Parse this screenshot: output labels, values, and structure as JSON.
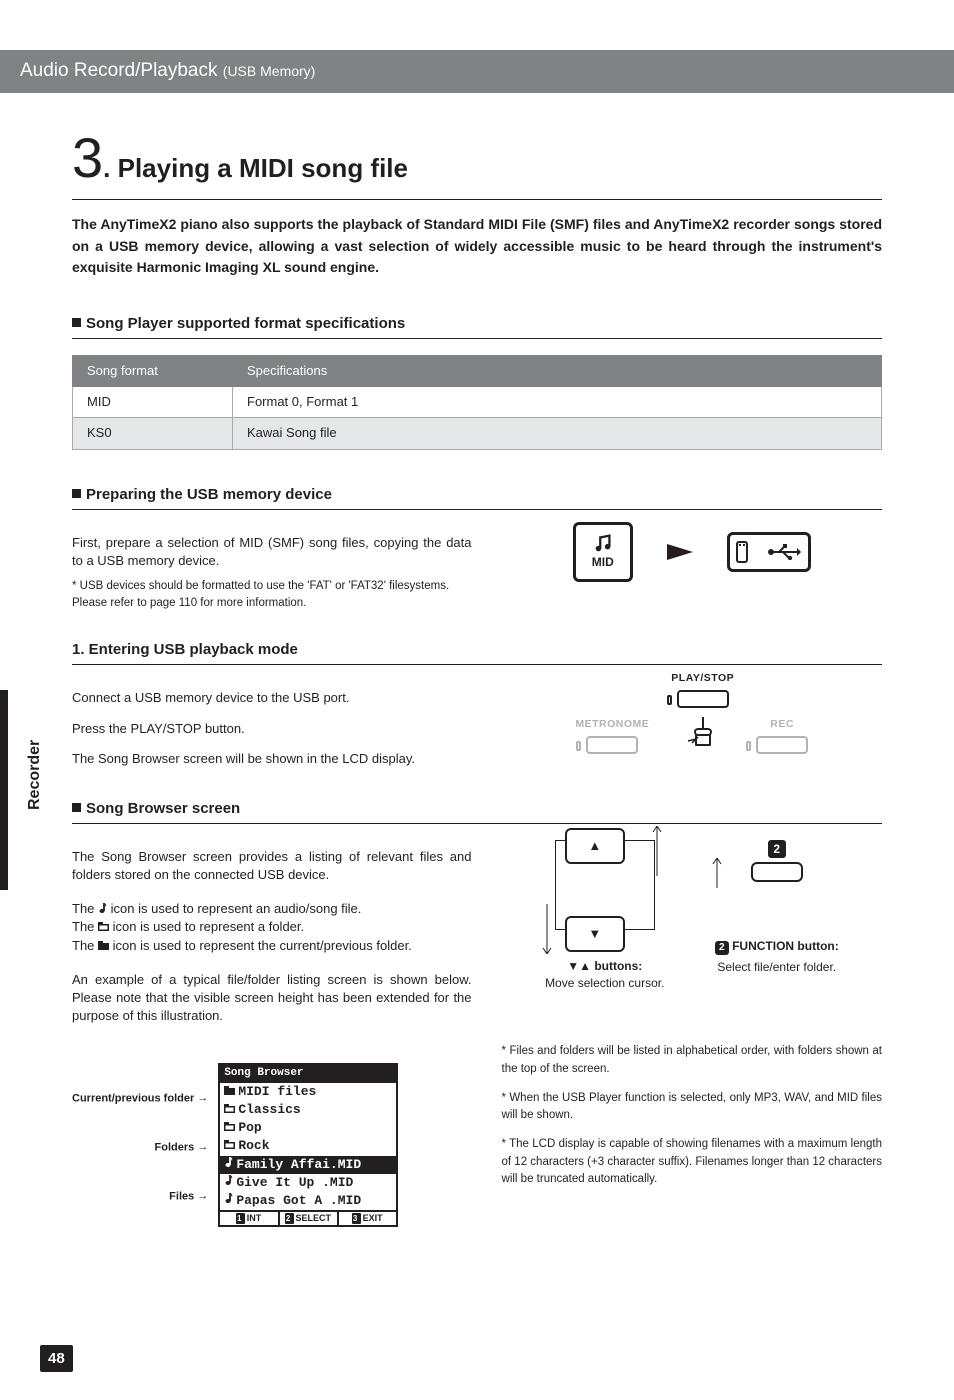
{
  "header": {
    "title": "Audio Record/Playback",
    "subtitle": "(USB Memory)"
  },
  "section_number": "3",
  "section_title": ". Playing a MIDI song file",
  "intro": "The AnyTimeX2 piano also supports the playback of Standard MIDI File (SMF) files and AnyTimeX2 recorder songs stored on a USB memory device, allowing a vast selection of widely accessible music to be heard through the instrument's exquisite Harmonic Imaging XL sound engine.",
  "spec_section": {
    "heading": "Song Player supported format specifications",
    "cols": [
      "Song format",
      "Specifications"
    ],
    "rows": [
      {
        "format": "MID",
        "spec": "Format 0, Format 1"
      },
      {
        "format": "KS0",
        "spec": "Kawai Song file"
      }
    ]
  },
  "prep_section": {
    "heading": "Preparing the USB memory device",
    "para": "First, prepare a selection of MID (SMF) song files, copying the data to a USB memory device.",
    "note": "* USB devices should be formatted to use the 'FAT' or 'FAT32' filesystems. Please refer to page 110 for more information.",
    "icon_label": "MID"
  },
  "step1": {
    "heading": "1. Entering USB playback mode",
    "p1": "Connect a USB memory device to the USB port.",
    "p2": "Press the PLAY/STOP button.",
    "p3": "The Song Browser screen will be shown in the LCD display.",
    "buttons": {
      "metronome": "METRONOME",
      "playstop": "PLAY/STOP",
      "rec": "REC"
    }
  },
  "browser": {
    "heading": "Song Browser screen",
    "p1": "The Song Browser screen provides a listing of relevant files and folders stored on the connected USB device.",
    "p2a": "The ",
    "p2b": " icon is used to represent an audio/song file.",
    "p3a": "The ",
    "p3b": " icon is used to represent a folder.",
    "p4a": "The ",
    "p4b": " icon is used to represent the current/previous folder.",
    "p5": "An example of a typical file/folder listing screen is shown below. Please note that the visible screen height has been extended for the purpose of this illustration.",
    "nav_caption_title": " buttons:",
    "nav_caption_body": "Move selection cursor.",
    "func_num": "2",
    "func_caption_title": " FUNCTION button:",
    "func_caption_body": "Select file/enter folder."
  },
  "lcd": {
    "title": "Song Browser",
    "labels": {
      "curr": "Current/previous folder",
      "folders": "Folders",
      "files": "Files"
    },
    "rows": [
      {
        "icon": "folder-up",
        "text": "MIDI files"
      },
      {
        "icon": "folder",
        "text": "Classics"
      },
      {
        "icon": "folder",
        "text": "Pop"
      },
      {
        "icon": "folder",
        "text": "Rock"
      },
      {
        "icon": "note",
        "text": "Family Affai.MID",
        "inv": true
      },
      {
        "icon": "note",
        "text": "Give It Up  .MID"
      },
      {
        "icon": "note",
        "text": "Papas Got A .MID"
      }
    ],
    "foot": [
      "INT",
      "SELECT",
      "EXIT"
    ]
  },
  "footnotes": {
    "n1": "* Files and folders will be listed in alphabetical order, with folders shown at the top of the screen.",
    "n2": "* When the USB Player function is selected, only MP3, WAV, and MID files will be shown.",
    "n3": "* The LCD display is capable of showing filenames with a maximum length of 12 characters (+3 character suffix). Filenames longer than 12 characters will be truncated automatically."
  },
  "side_tab": "Recorder",
  "page_number": "48"
}
